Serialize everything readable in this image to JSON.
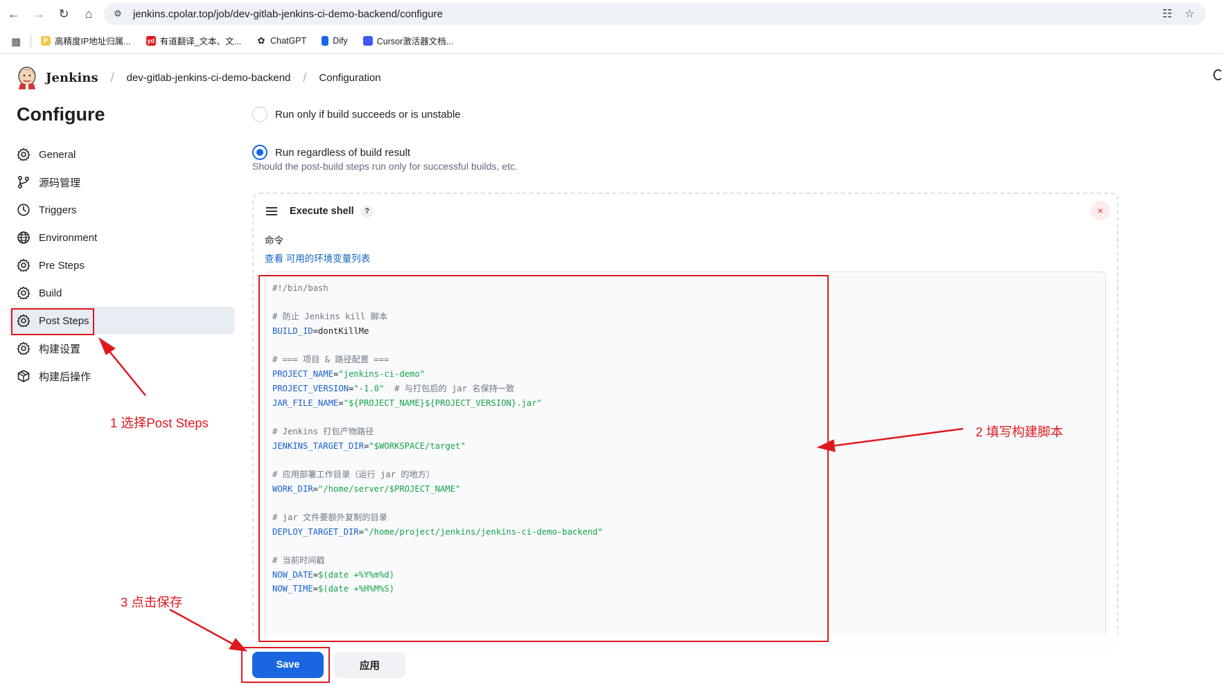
{
  "browser": {
    "url": "jenkins.cpolar.top/job/dev-gitlab-jenkins-ci-demo-backend/configure",
    "bookmarks": [
      {
        "label": "高精度IP地址归属...",
        "color": "#f2c94c",
        "icon": "ip-bookmark-icon"
      },
      {
        "label": "有道翻译_文本、文...",
        "color": "#e0191f",
        "icon": "youdao-bookmark-icon",
        "badge": "yd"
      },
      {
        "label": "ChatGPT",
        "color": "#222222",
        "icon": "chatgpt-bookmark-icon"
      },
      {
        "label": "Dify",
        "color": "#1c64f2",
        "icon": "dify-bookmark-icon"
      },
      {
        "label": "Cursor激活器文档...",
        "color": "#3d5afe",
        "icon": "cursor-bookmark-icon"
      }
    ]
  },
  "header": {
    "app_name": "Jenkins",
    "breadcrumb": [
      "dev-gitlab-jenkins-ci-demo-backend",
      "Configuration"
    ]
  },
  "sidebar": {
    "title": "Configure",
    "items": [
      {
        "label": "General",
        "icon": "gear-icon",
        "active": false
      },
      {
        "label": "源码管理",
        "icon": "branch-icon",
        "active": false
      },
      {
        "label": "Triggers",
        "icon": "clock-icon",
        "active": false
      },
      {
        "label": "Environment",
        "icon": "globe-icon",
        "active": false
      },
      {
        "label": "Pre Steps",
        "icon": "gear-icon",
        "active": false
      },
      {
        "label": "Build",
        "icon": "gear-icon",
        "active": false
      },
      {
        "label": "Post Steps",
        "icon": "gear-icon",
        "active": true
      },
      {
        "label": "构建设置",
        "icon": "gear-icon",
        "active": false
      },
      {
        "label": "构建后操作",
        "icon": "package-icon",
        "active": false
      }
    ]
  },
  "post_steps": {
    "options": [
      {
        "label": "Run only if build succeeds or is unstable",
        "selected": false
      },
      {
        "label": "Run regardless of build result",
        "selected": true
      }
    ],
    "description": "Should the post-build steps run only for successful builds, etc."
  },
  "execute_shell": {
    "title": "Execute shell",
    "help": "?",
    "close": "×",
    "command_label": "命令",
    "env_prefix": "查看 ",
    "env_link": "可用的环境变量列表",
    "code_lines": [
      [
        {
          "t": "#!/bin/bash",
          "c": "cm"
        }
      ],
      [],
      [
        {
          "t": "# 防止 Jenkins kill 脚本",
          "c": "cm"
        }
      ],
      [
        {
          "t": "BUILD_ID",
          "c": "var"
        },
        {
          "t": "=dontKillMe",
          "c": "op"
        }
      ],
      [],
      [
        {
          "t": "# === 项目 & 路径配置 ===",
          "c": "cm"
        }
      ],
      [
        {
          "t": "PROJECT_NAME",
          "c": "var"
        },
        {
          "t": "=",
          "c": "op"
        },
        {
          "t": "\"jenkins-ci-demo\"",
          "c": "str"
        }
      ],
      [
        {
          "t": "PROJECT_VERSION",
          "c": "var"
        },
        {
          "t": "=",
          "c": "op"
        },
        {
          "t": "\"-1.0\"",
          "c": "str"
        },
        {
          "t": "  # 与打包后的 jar 名保持一致",
          "c": "cm"
        }
      ],
      [
        {
          "t": "JAR_FILE_NAME",
          "c": "var"
        },
        {
          "t": "=",
          "c": "op"
        },
        {
          "t": "\"${PROJECT_NAME}${PROJECT_VERSION}.jar\"",
          "c": "str"
        }
      ],
      [],
      [
        {
          "t": "# Jenkins 打包产物路径",
          "c": "cm"
        }
      ],
      [
        {
          "t": "JENKINS_TARGET_DIR",
          "c": "var"
        },
        {
          "t": "=",
          "c": "op"
        },
        {
          "t": "\"$WORKSPACE/target\"",
          "c": "str"
        }
      ],
      [],
      [
        {
          "t": "# 应用部署工作目录（运行 jar 的地方）",
          "c": "cm"
        }
      ],
      [
        {
          "t": "WORK_DIR",
          "c": "var"
        },
        {
          "t": "=",
          "c": "op"
        },
        {
          "t": "\"/home/server/$PROJECT_NAME\"",
          "c": "str"
        }
      ],
      [],
      [
        {
          "t": "# jar 文件要额外复制的目录",
          "c": "cm"
        }
      ],
      [
        {
          "t": "DEPLOY_TARGET_DIR",
          "c": "var"
        },
        {
          "t": "=",
          "c": "op"
        },
        {
          "t": "\"/home/project/jenkins/jenkins-ci-demo-backend\"",
          "c": "str"
        }
      ],
      [],
      [
        {
          "t": "# 当前时间戳",
          "c": "cm"
        }
      ],
      [
        {
          "t": "NOW_DATE",
          "c": "var"
        },
        {
          "t": "=",
          "c": "op"
        },
        {
          "t": "$(date +%Y%m%d)",
          "c": "str"
        }
      ],
      [
        {
          "t": "NOW_TIME",
          "c": "var"
        },
        {
          "t": "=",
          "c": "op"
        },
        {
          "t": "$(date +%H%M%S)",
          "c": "str"
        }
      ]
    ]
  },
  "actions": {
    "save": "Save",
    "apply": "应用"
  },
  "annotations": {
    "step1": "1 选择Post Steps",
    "step2": "2 填写构建脚本",
    "step3": "3 点击保存",
    "color": "#e0191f"
  }
}
